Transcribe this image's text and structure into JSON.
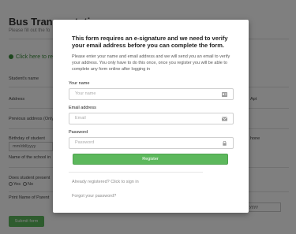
{
  "background": {
    "title": "Bus Transportation",
    "subtitle": "Please fill out the fo",
    "link": "Click here to rea",
    "labels": {
      "student_name": "Student's name",
      "address": "Address",
      "previous_address": "Previous address (Only",
      "birthday": "Birthday of student",
      "school": "Name of the school in",
      "disenrolled": "Does student present",
      "print_name": "Print Name of Parent"
    },
    "right_labels": {
      "apt": "Apt",
      "phone": "hone"
    },
    "birthday_placeholder": "mm/dd/yyyy",
    "date_placeholder": "yyyy",
    "radio_yes": "Yes",
    "radio_no": "No",
    "submit": "Submit form"
  },
  "modal": {
    "heading": "This form requires an e-signature and we need to verify your email address before you can complete the form.",
    "description": "Please enter your name and email address and we will send you an email to verify your address. You only have to do this once, once you register you will be able to complete any form online after logging in",
    "name_label": "Your name",
    "name_placeholder": "Your name",
    "email_label": "Email address",
    "email_placeholder": "Email",
    "password_label": "Password",
    "password_placeholder": "Password",
    "register_button": "Register",
    "already_registered": "Already registered? Click to sign in",
    "forgot_password": "Forgot your password?"
  },
  "colors": {
    "accent_green": "#5cb85c",
    "link_green": "#3c8d3c"
  },
  "icons": {
    "name_field": "user-card-icon",
    "email_field": "envelope-icon",
    "password_field": "lock-icon"
  }
}
